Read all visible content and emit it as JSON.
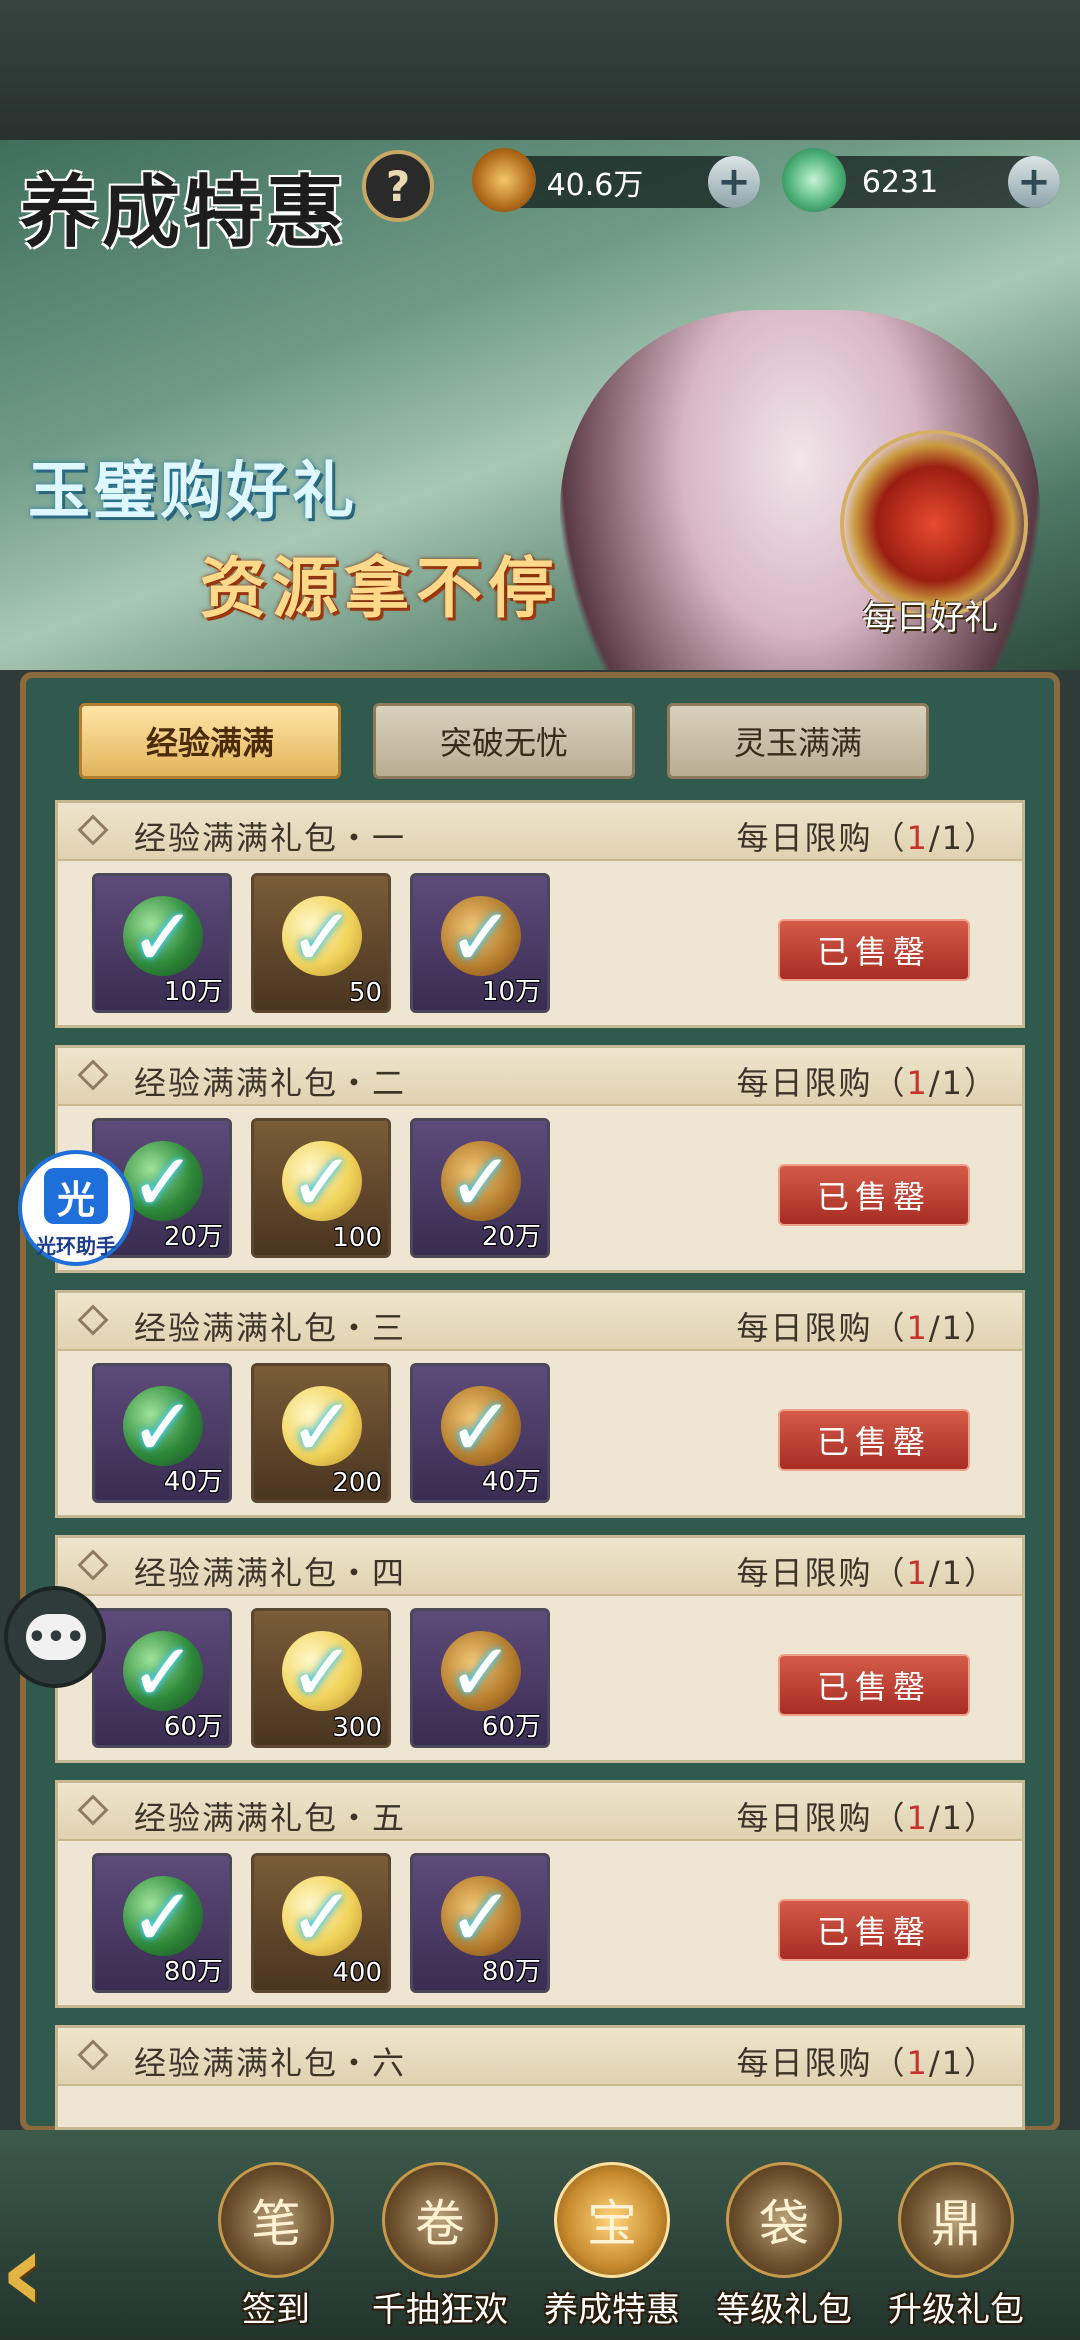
{
  "header": {
    "title": "养成特惠",
    "help_symbol": "?",
    "currencies": [
      {
        "icon": "copper-coin-icon",
        "value": "40.6万",
        "plus": "+"
      },
      {
        "icon": "jade-icon",
        "value": "6231",
        "plus": "+"
      }
    ]
  },
  "banner": {
    "slogan_line1": "玉璧购好礼",
    "slogan_line2": "资源拿不停",
    "daily_gift_label": "每日好礼"
  },
  "tabs": [
    {
      "label": "经验满满",
      "active": true
    },
    {
      "label": "突破无忧",
      "active": false
    },
    {
      "label": "灵玉满满",
      "active": false
    }
  ],
  "packs": [
    {
      "title": "经验满满礼包・一",
      "limit_prefix": "每日限购（",
      "limit_cur": "1",
      "limit_rest": "/1）",
      "items": [
        {
          "kind": "green",
          "qty": "10万"
        },
        {
          "kind": "gold",
          "qty": "50"
        },
        {
          "kind": "coin",
          "qty": "10万"
        }
      ],
      "status": "已售罄"
    },
    {
      "title": "经验满满礼包・二",
      "limit_prefix": "每日限购（",
      "limit_cur": "1",
      "limit_rest": "/1）",
      "items": [
        {
          "kind": "green",
          "qty": "20万"
        },
        {
          "kind": "gold",
          "qty": "100"
        },
        {
          "kind": "coin",
          "qty": "20万"
        }
      ],
      "status": "已售罄"
    },
    {
      "title": "经验满满礼包・三",
      "limit_prefix": "每日限购（",
      "limit_cur": "1",
      "limit_rest": "/1）",
      "items": [
        {
          "kind": "green",
          "qty": "40万"
        },
        {
          "kind": "gold",
          "qty": "200"
        },
        {
          "kind": "coin",
          "qty": "40万"
        }
      ],
      "status": "已售罄"
    },
    {
      "title": "经验满满礼包・四",
      "limit_prefix": "每日限购（",
      "limit_cur": "1",
      "limit_rest": "/1）",
      "items": [
        {
          "kind": "green",
          "qty": "60万"
        },
        {
          "kind": "gold",
          "qty": "300"
        },
        {
          "kind": "coin",
          "qty": "60万"
        }
      ],
      "status": "已售罄"
    },
    {
      "title": "经验满满礼包・五",
      "limit_prefix": "每日限购（",
      "limit_cur": "1",
      "limit_rest": "/1）",
      "items": [
        {
          "kind": "green",
          "qty": "80万"
        },
        {
          "kind": "gold",
          "qty": "400"
        },
        {
          "kind": "coin",
          "qty": "80万"
        }
      ],
      "status": "已售罄"
    },
    {
      "title": "经验满满礼包・六",
      "limit_prefix": "每日限购（",
      "limit_cur": "1",
      "limit_rest": "/1）"
    }
  ],
  "check_symbol": "✓",
  "floating_helper": {
    "icon_text": "光",
    "label": "光环助手"
  },
  "chat_button": {
    "symbol": "•••"
  },
  "back_symbol": "‹",
  "bottom_nav": [
    {
      "label": "签到",
      "icon": "sign-in-icon",
      "glyph": "笔",
      "active": false
    },
    {
      "label": "千抽狂欢",
      "icon": "scroll-icon",
      "glyph": "卷",
      "active": false
    },
    {
      "label": "养成特惠",
      "icon": "chest-icon",
      "glyph": "宝",
      "active": true
    },
    {
      "label": "等级礼包",
      "icon": "bag-icon",
      "glyph": "袋",
      "active": false
    },
    {
      "label": "升级礼包",
      "icon": "pot-icon",
      "glyph": "鼎",
      "active": false
    }
  ],
  "colors": {
    "sold_red": "#b8342a",
    "panel_green": "#2f5a4d",
    "accent_gold": "#e2b45c",
    "limit_red": "#c7322a"
  }
}
